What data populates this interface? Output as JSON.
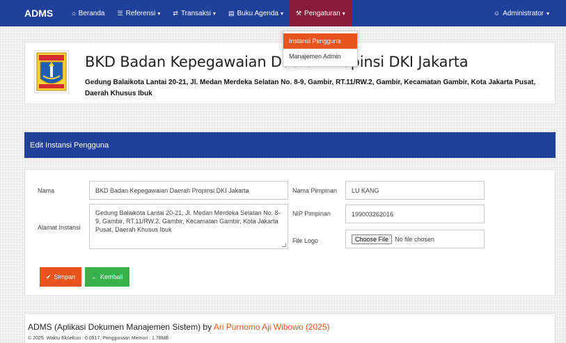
{
  "navbar": {
    "brand": "ADMS",
    "items": [
      {
        "label": "Beranda",
        "icon": "home-icon",
        "glyph": "⌂"
      },
      {
        "label": "Referensi",
        "icon": "list-icon",
        "glyph": "☰"
      },
      {
        "label": "Transaksi",
        "icon": "transfer-icon",
        "glyph": "⇄"
      },
      {
        "label": "Buku Agenda",
        "icon": "book-icon",
        "glyph": "▤"
      },
      {
        "label": "Pengaturan",
        "icon": "wrench-icon",
        "glyph": "⚒"
      }
    ],
    "user": "Administrator",
    "user_glyph": "☺"
  },
  "dropdown": {
    "items": [
      "Instansi Pengguna",
      "Manajemen Admin"
    ]
  },
  "instansi": {
    "name": "BKD Badan Kepegawaian Daerah Propinsi DKI Jakarta",
    "address": "Gedung Balaikota Lantai 20-21, Jl. Medan Merdeka Selatan No. 8-9, Gambir, RT.11/RW.2, Gambir, Kecamatan Gambir, Kota Jakarta Pusat, Daerah Khusus Ibuk"
  },
  "section": {
    "title": "Edit Instansi Pengguna"
  },
  "form": {
    "nama_label": "Nama",
    "nama_value": "BKD Badan Kepegawaian Daerah Propinsi DKI Jakarta",
    "alamat_label": "Alamat Instansi",
    "alamat_value": "Gedung Balaikota Lantai 20-21, Jl. Medan Merdeka Selatan No. 8-9, Gambir, RT.11/RW.2, Gambir, Kecamatan Gambir, Kota Jakarta Pusat, Daerah Khusus Ibuk",
    "pimpinan_label": "Nama Pimpinan",
    "pimpinan_value": "LU KANG",
    "nip_label": "NIP Pimpinan",
    "nip_value": "199003262016",
    "logo_label": "File Logo",
    "file_button": "Choose File",
    "file_status": "No file chosen",
    "save_label": "Simpan",
    "back_label": "Kembali"
  },
  "footer": {
    "title_prefix": "ADMS (Aplikasi Dokumen Manajemen Sistem) by ",
    "author": "Ari Purnomo Aji Wibowo (2025)",
    "meta": "© 2025. Waktu Eksekusi : 0.0917, Penggunaan Memori : 1.78MB"
  },
  "colors": {
    "navbar": "#21409a",
    "active_menu": "#8a1c3b",
    "accent_orange": "#e8541e",
    "button_green": "#38b24a"
  }
}
